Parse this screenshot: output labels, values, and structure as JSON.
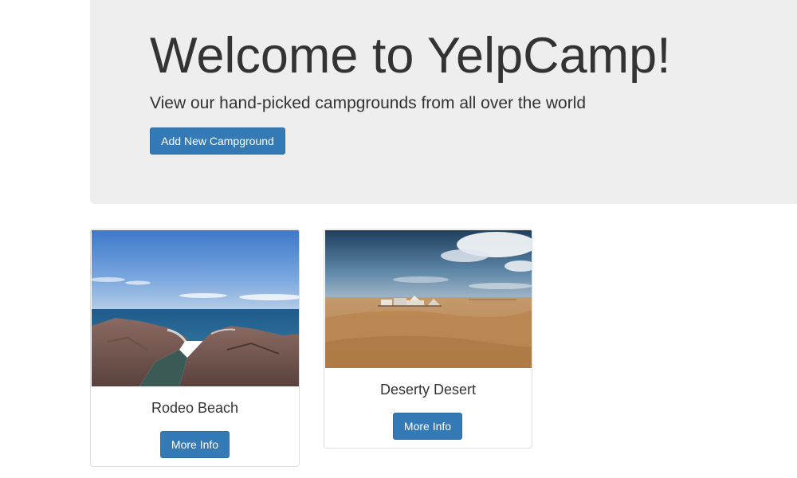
{
  "jumbotron": {
    "title": "Welcome to YelpCamp!",
    "subtitle": "View our hand-picked campgrounds from all over the world",
    "add_button_label": "Add New Campground"
  },
  "campgrounds": [
    {
      "name": "Rodeo Beach",
      "button_label": "More Info",
      "image": "beach-rocks-photo"
    },
    {
      "name": "Deserty Desert",
      "button_label": "More Info",
      "image": "desert-tents-photo"
    }
  ],
  "colors": {
    "jumbotron_bg": "#eeeeee",
    "primary_button": "#337ab7",
    "primary_button_border": "#2e6da4",
    "card_border": "#dddddd",
    "text": "#333333"
  }
}
